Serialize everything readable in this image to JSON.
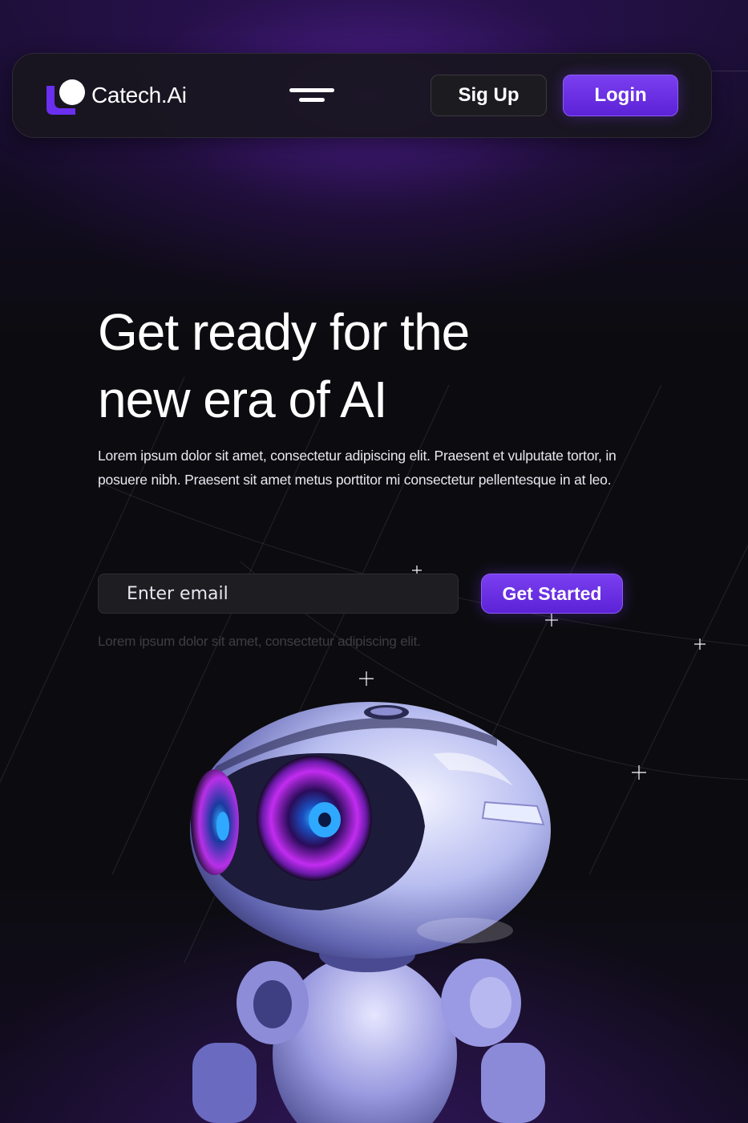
{
  "brand": {
    "name": "Catech.Ai",
    "logo_icon": "catech-logo-icon",
    "accent_color": "#6a2ff0"
  },
  "nav": {
    "menu_icon": "hamburger-menu-icon",
    "signup_label": "Sig Up",
    "login_label": "Login"
  },
  "hero": {
    "title_line1": "Get ready for the",
    "title_line2": "new era of AI",
    "description": "Lorem ipsum dolor sit amet, consectetur adipiscing elit. Praesent et vulputate tortor, in posuere nibh. Praesent sit amet metus porttitor mi consectetur pellentesque in at leo.",
    "email_placeholder": "Enter email",
    "cta_label": "Get Started",
    "note": "Lorem ipsum dolor sit amet, consectetur adipiscing elit."
  },
  "illustration": {
    "icon": "robot-illustration-icon"
  }
}
